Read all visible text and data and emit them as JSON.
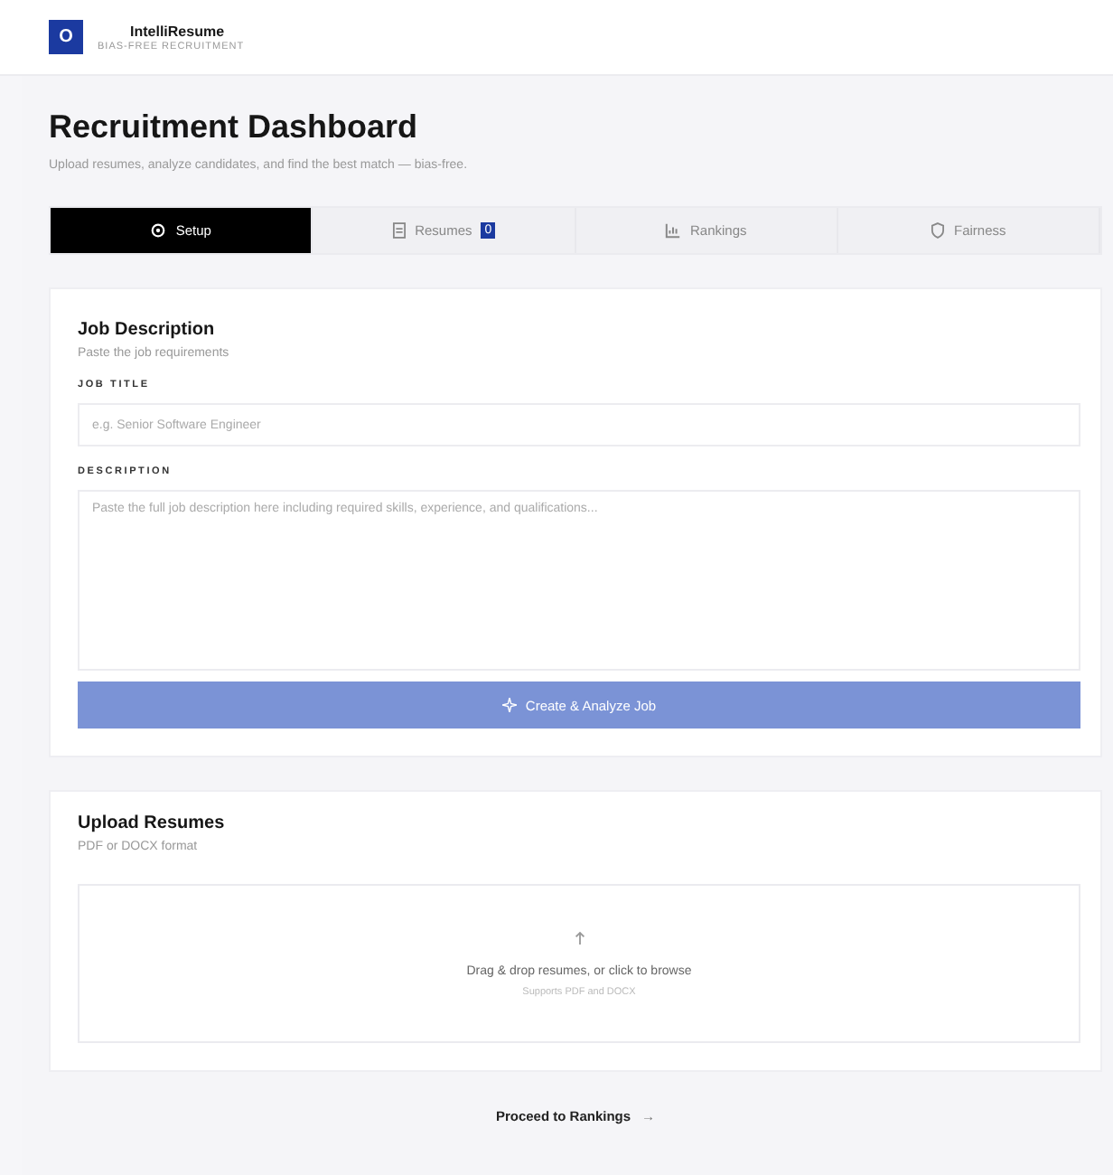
{
  "brand": {
    "logo": "O",
    "name": "IntelliResume",
    "tagline": "BIAS-FREE RECRUITMENT"
  },
  "page": {
    "title": "Recruitment Dashboard",
    "subtitle": "Upload resumes, analyze candidates, and find the best match — bias-free."
  },
  "tabs": [
    {
      "label": "Setup",
      "kind": "setup",
      "selected": true
    },
    {
      "label": "Resumes",
      "kind": "resumes",
      "selected": false,
      "badge": "0"
    },
    {
      "label": "Rankings",
      "kind": "rankings",
      "selected": false
    },
    {
      "label": "Fairness",
      "kind": "fairness",
      "selected": false
    }
  ],
  "job_card": {
    "title": "Job Description",
    "subtitle": "Paste the job requirements",
    "fields": [
      {
        "kind": "input",
        "label": "JOB TITLE",
        "placeholder": "e.g. Senior Software Engineer"
      },
      {
        "kind": "textarea",
        "label": "DESCRIPTION",
        "placeholder": "Paste the full job description here including required skills, experience, and qualifications..."
      }
    ],
    "button": {
      "label": "Create & Analyze Job",
      "disabled": true
    }
  },
  "upload_card": {
    "title": "Upload Resumes",
    "subtitle": "PDF or DOCX format",
    "dropzone": {
      "text": "Drag & drop resumes, or click to browse",
      "hint": "Supports PDF and DOCX"
    }
  },
  "proceed": {
    "label": "Proceed to Rankings",
    "arrow": "→"
  }
}
